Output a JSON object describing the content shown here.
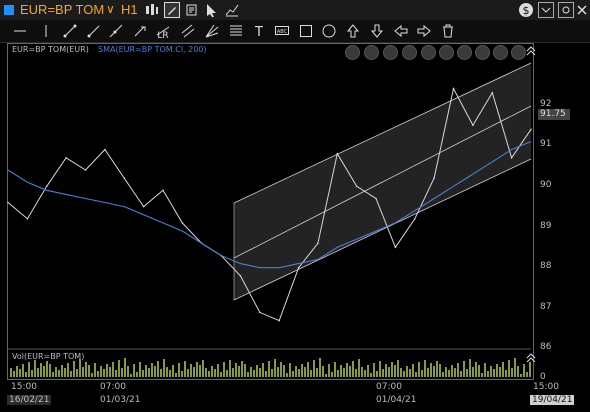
{
  "header": {
    "instrument": "EUR=BP TOM",
    "timeframe": "H1",
    "chevron": "∨"
  },
  "chart": {
    "legend_instrument": "EUR=BP TOM(EUR)",
    "legend_sma": "SMA(EUR=BP TOM.Cl, 200)",
    "volume_label": "Vol(EUR=BP TOM)",
    "price_tag": "91.75",
    "y_ticks": [
      "92",
      "91",
      "90",
      "89",
      "88",
      "87",
      "86",
      "0"
    ]
  },
  "xaxis": {
    "time_labels": [
      "15:00",
      "07:00",
      "07:00",
      "15:00"
    ],
    "date_labels": [
      "16/02/21",
      "01/03/21",
      "01/04/21",
      "19/04/21"
    ]
  },
  "chart_data": {
    "type": "line",
    "title": "",
    "ylim": [
      86,
      93
    ],
    "x": [
      "16/02/21",
      "18/02/21",
      "20/02/21",
      "23/02/21",
      "25/02/21",
      "27/02/21",
      "01/03/21",
      "03/03/21",
      "05/03/21",
      "08/03/21",
      "10/03/21",
      "12/03/21",
      "15/03/21",
      "17/03/21",
      "19/03/21",
      "22/03/21",
      "24/03/21",
      "26/03/21",
      "29/03/21",
      "31/03/21",
      "01/04/21",
      "05/04/21",
      "07/04/21",
      "09/04/21",
      "12/04/21",
      "14/04/21",
      "16/04/21",
      "19/04/21"
    ],
    "series": [
      {
        "values": [
          89.5,
          89.1,
          89.9,
          90.6,
          90.3,
          90.8,
          90.1,
          89.4,
          89.8,
          89.0,
          88.5,
          88.2,
          87.7,
          86.8,
          86.6,
          87.9,
          88.5,
          90.7,
          89.9,
          89.6,
          88.4,
          89.1,
          90.1,
          92.3,
          91.4,
          92.2,
          90.6,
          91.3
        ]
      },
      {
        "values": [
          90.3,
          90.0,
          89.8,
          89.7,
          89.6,
          89.5,
          89.4,
          89.2,
          89.0,
          88.8,
          88.5,
          88.2,
          88.0,
          87.9,
          87.9,
          88.0,
          88.1,
          88.4,
          88.6,
          88.8,
          89.0,
          89.3,
          89.6,
          89.9,
          90.2,
          90.5,
          90.8,
          91.0
        ]
      }
    ]
  },
  "style": {
    "accent": "#f5a623",
    "sma_color": "#4a7fd8",
    "price_color": "#d8d8d8"
  },
  "icons": [
    "candlestick-icon",
    "draw-icon",
    "settings-icon",
    "dropdown-icon",
    "dollar-icon",
    "close-icon"
  ]
}
